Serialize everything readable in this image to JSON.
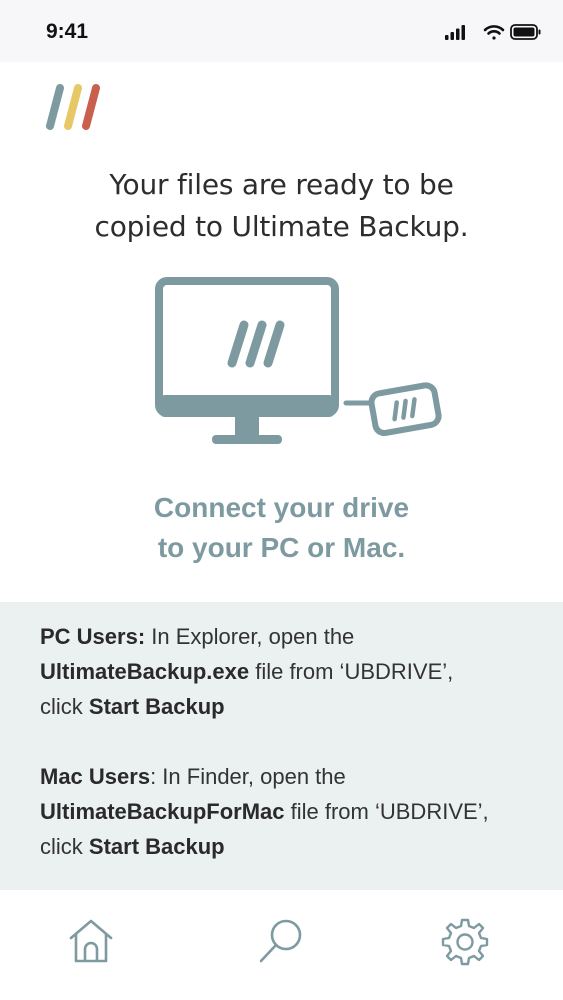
{
  "status_bar": {
    "time": "9:41",
    "icons": [
      "signal-icon",
      "wifi-icon",
      "battery-icon"
    ]
  },
  "logo": {
    "icon": "ultimate-backup-logo",
    "colors": [
      "#7e9aa1",
      "#e8c767",
      "#c8604d"
    ]
  },
  "headline": {
    "line1": "Your files are ready to be",
    "line2": "copied to Ultimate Backup."
  },
  "illustration": {
    "icon": "computer-with-drive-illustration",
    "color": "#7e9aa1"
  },
  "connect": {
    "line1": "Connect your drive",
    "line2": "to your PC or Mac."
  },
  "instructions": {
    "pc": {
      "label": "PC Users:",
      "text1": " In Explorer, open the ",
      "file": "UltimateBackup.exe",
      "text2": " file from ‘UBDRIVE’,",
      "text3": "click ",
      "action": "Start Backup"
    },
    "mac": {
      "label": "Mac Users",
      "text1": ": In Finder, open the ",
      "file": "UltimateBackupForMac",
      "text2": " file from ‘UBDRIVE’,",
      "text3": "click ",
      "action": "Start Backup"
    }
  },
  "tab_bar": {
    "tabs": [
      {
        "icon": "home-icon"
      },
      {
        "icon": "search-icon"
      },
      {
        "icon": "gear-icon"
      }
    ],
    "icon_color": "#7e9aa1"
  }
}
